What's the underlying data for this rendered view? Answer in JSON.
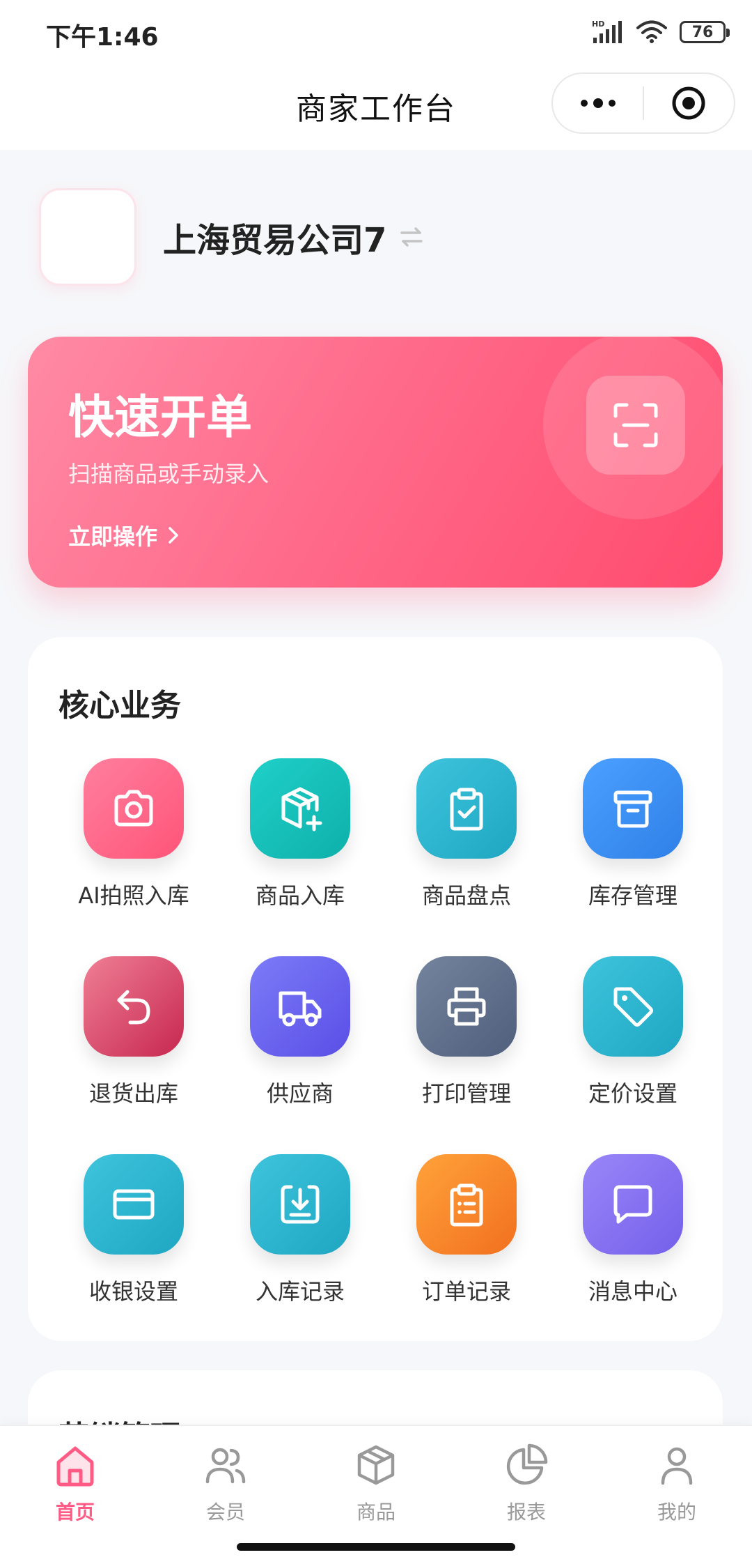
{
  "status": {
    "time": "下午1:46",
    "battery": "76",
    "network": "HD"
  },
  "navbar": {
    "title": "商家工作台"
  },
  "merchant": {
    "name": "上海贸易公司7"
  },
  "quick_order": {
    "title": "快速开单",
    "subtitle": "扫描商品或手动录入",
    "action": "立即操作"
  },
  "core": {
    "title": "核心业务",
    "items": [
      {
        "label": "AI拍照入库",
        "icon": "camera-icon",
        "color_from": "#ff7f9e",
        "color_to": "#ff5478"
      },
      {
        "label": "商品入库",
        "icon": "box-add-icon",
        "color_from": "#1fd0c8",
        "color_to": "#0eb0aa"
      },
      {
        "label": "商品盘点",
        "icon": "clipboard-check-icon",
        "color_from": "#3ec4dc",
        "color_to": "#1ea6c2"
      },
      {
        "label": "库存管理",
        "icon": "archive-icon",
        "color_from": "#4ba0ff",
        "color_to": "#2f80e8"
      },
      {
        "label": "退货出库",
        "icon": "return-icon",
        "color_from": "#ef7f95",
        "color_to": "#c7274f"
      },
      {
        "label": "供应商",
        "icon": "truck-icon",
        "color_from": "#7c7cf8",
        "color_to": "#5a4ee6"
      },
      {
        "label": "打印管理",
        "icon": "printer-icon",
        "color_from": "#74849e",
        "color_to": "#4f5f7c"
      },
      {
        "label": "定价设置",
        "icon": "tag-icon",
        "color_from": "#3ec4dc",
        "color_to": "#1ea6c2"
      },
      {
        "label": "收银设置",
        "icon": "card-icon",
        "color_from": "#3ec4dc",
        "color_to": "#1ea6c2"
      },
      {
        "label": "入库记录",
        "icon": "download-icon",
        "color_from": "#3ec4dc",
        "color_to": "#1ea6c2"
      },
      {
        "label": "订单记录",
        "icon": "order-list-icon",
        "color_from": "#ffa23a",
        "color_to": "#f2701f"
      },
      {
        "label": "消息中心",
        "icon": "message-icon",
        "color_from": "#9a86f8",
        "color_to": "#7460ea"
      }
    ]
  },
  "marketing": {
    "title": "营销管理"
  },
  "tabbar": {
    "items": [
      {
        "label": "首页",
        "icon": "home-icon",
        "active": true
      },
      {
        "label": "会员",
        "icon": "members-icon",
        "active": false
      },
      {
        "label": "商品",
        "icon": "product-box-icon",
        "active": false
      },
      {
        "label": "报表",
        "icon": "pie-chart-icon",
        "active": false
      },
      {
        "label": "我的",
        "icon": "user-icon",
        "active": false
      }
    ]
  },
  "colors": {
    "accent": "#ff5b85",
    "tab_inactive": "#999999"
  }
}
